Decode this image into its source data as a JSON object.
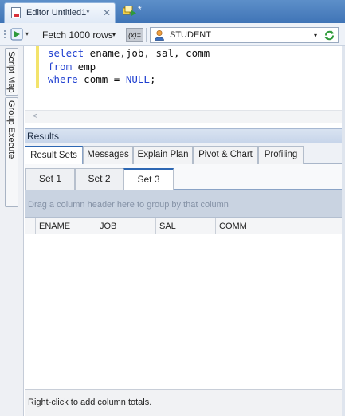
{
  "tabs": {
    "editor_label": "Editor Untitled1*",
    "close_glyph": "✕",
    "exec_label": "*"
  },
  "toolbar": {
    "fetch_label": "Fetch 1000 rows",
    "dropdown_glyph": "▾",
    "variables_label": "(x)=",
    "connection": "STUDENT"
  },
  "side_panels": [
    "Script Map",
    "Group Execute"
  ],
  "editor": {
    "lines": [
      {
        "kw": "select",
        "rest": " ename,job, sal, comm"
      },
      {
        "kw": "from",
        "rest": " emp"
      },
      {
        "kw": "where",
        "rest": " comm = ",
        "null": "NULL",
        "tail": ";"
      }
    ]
  },
  "results": {
    "title": "Results",
    "tabs": [
      "Result Sets",
      "Messages",
      "Explain Plan",
      "Pivot & Chart",
      "Profiling"
    ],
    "active_tab": "Result Sets",
    "sets": [
      "Set 1",
      "Set 2",
      "Set 3"
    ],
    "active_set": "Set 3",
    "group_hint": "Drag a column header here to group by that column",
    "columns": [
      "ENAME",
      "JOB",
      "SAL",
      "COMM"
    ],
    "footer": "Right-click to add column totals."
  },
  "colors": {
    "accent": "#2d67b3",
    "tab_strip": "#3f74b6",
    "keyword": "#1f3fd0"
  }
}
